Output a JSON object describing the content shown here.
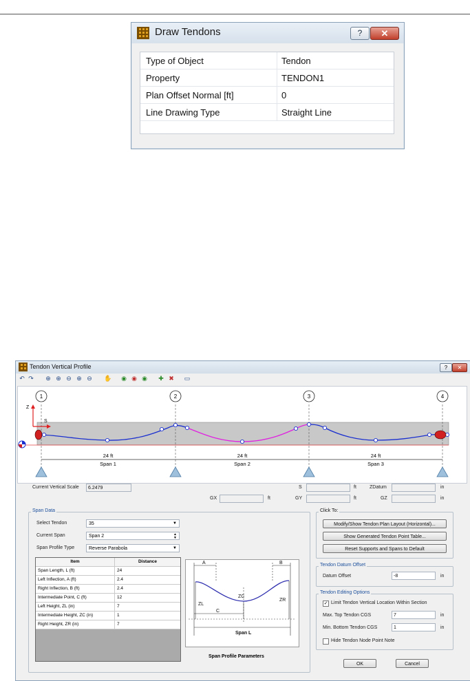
{
  "draw_tendons": {
    "title": "Draw Tendons",
    "help_label": "?",
    "close_label": "✕",
    "rows": [
      {
        "key": "Type of Object",
        "value": "Tendon"
      },
      {
        "key": "Property",
        "value": "TENDON1"
      },
      {
        "key": "Plan Offset Normal  [ft]",
        "value": "0"
      },
      {
        "key": "Line Drawing Type",
        "value": "Straight Line"
      }
    ]
  },
  "profile": {
    "title": "Tendon Vertical Profile",
    "help_label": "?",
    "close_label": "✕",
    "toolbar_icons": [
      "undo-icon",
      "redo-icon",
      "zoom-in-icon",
      "zoom-window-icon",
      "zoom-out-icon",
      "zoom-prev-icon",
      "zoom-extents-icon",
      "pan-icon",
      "view-icon-1",
      "view-icon-2",
      "view-icon-3",
      "add-point-icon",
      "delete-point-icon",
      "refresh-icon"
    ],
    "axis_z": "Z",
    "axis_s": "S",
    "supports": [
      "1",
      "2",
      "3",
      "4"
    ],
    "spans": [
      {
        "length": "24 ft",
        "name": "Span 1"
      },
      {
        "length": "24 ft",
        "name": "Span 2"
      },
      {
        "length": "24 ft",
        "name": "Span 3"
      }
    ],
    "vertical_scale_label": "Current Vertical Scale",
    "vertical_scale_value": "6.2479",
    "s_label": "S",
    "s_unit": "ft",
    "zdatum_label": "ZDatum",
    "zdatum_unit": "in",
    "gx_label": "GX",
    "gx_unit": "ft",
    "gy_label": "GY",
    "gy_unit": "ft",
    "gz_label": "GZ",
    "gz_unit": "in",
    "span_data": {
      "group": "Span Data",
      "select_tendon_label": "Select Tendon",
      "select_tendon_value": "35",
      "current_span_label": "Current Span",
      "current_span_value": "Span 2",
      "profile_type_label": "Span Profile Type",
      "profile_type_value": "Reverse Parabola",
      "table_headers": [
        "Item",
        "Distance"
      ],
      "table_rows": [
        [
          "Span Length, L  (ft)",
          "24"
        ],
        [
          "Left Inflection, A  (ft)",
          "2.4"
        ],
        [
          "Right Inflection, B  (ft)",
          "2.4"
        ],
        [
          "Intermediate Point, C  (ft)",
          "12"
        ],
        [
          "Left Height, ZL  (in)",
          "7"
        ],
        [
          "Intermediate Height, ZC  (in)",
          "1"
        ],
        [
          "Right Height, ZR  (in)",
          "7"
        ]
      ],
      "diagram_labels": {
        "a": "A",
        "b": "B",
        "c": "C",
        "zl": "ZL",
        "zc": "ZC",
        "zr": "ZR",
        "l": "Span L"
      },
      "diagram_caption": "Span Profile Parameters"
    },
    "click_to": {
      "group": "Click To:",
      "btn1": "Modify/Show Tendon Plan Layout (Horizontal)...",
      "btn2": "Show Generated Tendon Point Table...",
      "btn3": "Reset Supports and Spans to Default"
    },
    "datum": {
      "group": "Tendon Datum Offset",
      "label": "Datum Offset",
      "value": "-8",
      "unit": "in"
    },
    "editing": {
      "group": "Tendon Editing Options",
      "limit_label": "Limit Tendon Vertical Location Within Section",
      "limit_checked": "✓",
      "max_label": "Max. Top Tendon CGS",
      "max_value": "7",
      "max_unit": "in",
      "min_label": "Min. Bottom Tendon CGS",
      "min_value": "1",
      "min_unit": "in",
      "hide_label": "Hide Tendon Node Point Note"
    },
    "ok_label": "OK",
    "cancel_label": "Cancel"
  }
}
